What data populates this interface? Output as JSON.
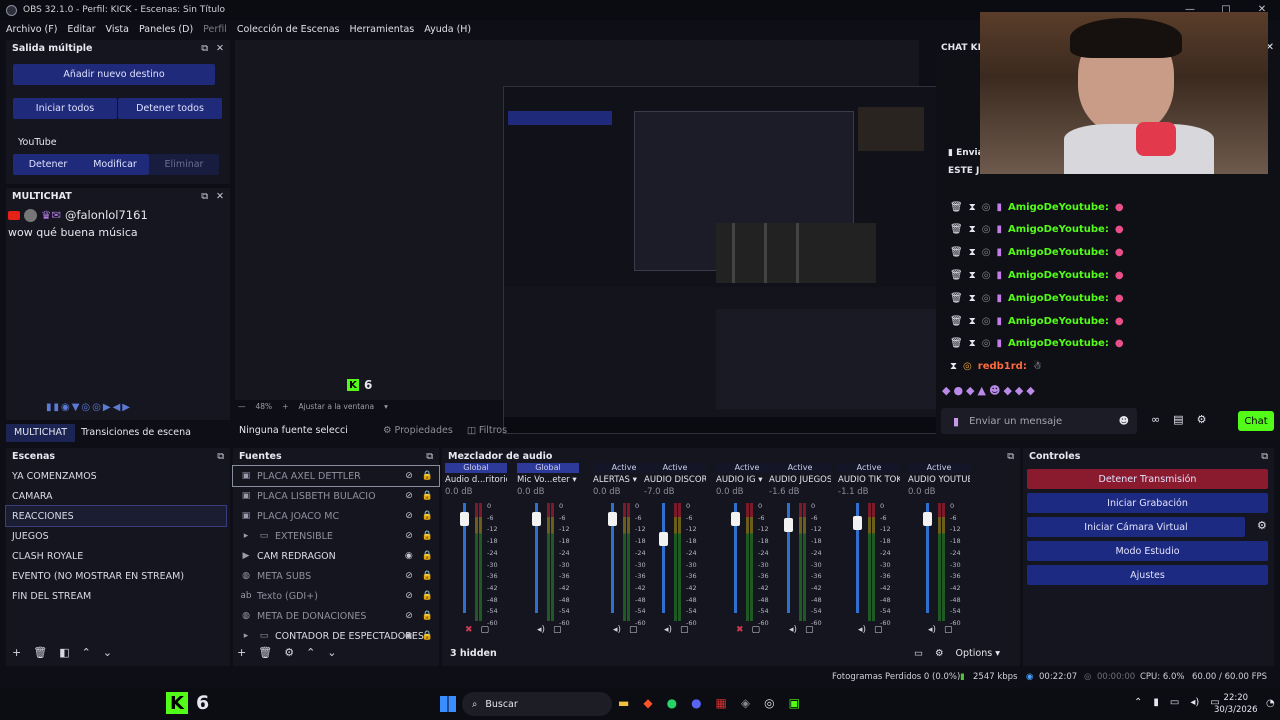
{
  "window": {
    "title": "OBS 32.1.0 - Perfil: KICK - Escenas: Sin Título",
    "controls": [
      "—",
      "□",
      "✕"
    ]
  },
  "menu": {
    "items": [
      "Archivo (F)",
      "Editar",
      "Vista",
      "Paneles (D)",
      "Perfil",
      "Colección de Escenas",
      "Herramientas",
      "Ayuda (H)"
    ]
  },
  "salida": {
    "title": "Salida múltiple",
    "add": "Añadir nuevo destino",
    "start_all": "Iniciar todos",
    "stop_all": "Detener todos",
    "service": "YouTube",
    "stop": "Detener",
    "modify": "Modificar",
    "delete": "Eliminar"
  },
  "multichat": {
    "title": "MULTICHAT",
    "user": "@falonlol7161",
    "message": "wow qué buena música"
  },
  "tabs": {
    "multichat": "MULTICHAT",
    "transitions": "Transiciones de escena"
  },
  "preview": {
    "zoom": "48%",
    "fit": "Ajustar a la ventana",
    "no_source": "Ninguna fuente seleccionada",
    "props": "Propiedades",
    "filters": "Filtros",
    "kick_count": "6"
  },
  "scenes": {
    "title": "Escenas",
    "items": [
      "YA COMENZAMOS",
      "CAMARA",
      "REACCIONES",
      "JUEGOS",
      "CLASH ROYALE",
      "EVENTO (NO MOSTRAR EN STREAM)",
      "FIN DEL STREAM"
    ],
    "selected": 2
  },
  "sources": {
    "title": "Fuentes",
    "items": [
      {
        "name": "PLACA AXEL DETTLER",
        "icon": "image-icon",
        "on": false
      },
      {
        "name": "PLACA LISBETH BULACIO",
        "icon": "image-icon",
        "on": false
      },
      {
        "name": "PLACA JOACO MC",
        "icon": "image-icon",
        "on": false
      },
      {
        "name": "EXTENSIBLE",
        "icon": "folder-icon",
        "on": false
      },
      {
        "name": "CAM REDRAGON",
        "icon": "camera-icon",
        "on": true
      },
      {
        "name": "META SUBS",
        "icon": "globe-icon",
        "on": false
      },
      {
        "name": "Texto (GDI+)",
        "icon": "text-icon",
        "on": false
      },
      {
        "name": "META DE DONACIONES",
        "icon": "globe-icon",
        "on": false
      },
      {
        "name": "CONTADOR DE ESPECTADORES",
        "icon": "folder-icon",
        "on": true
      }
    ]
  },
  "mixer": {
    "title": "Mezclador de audio",
    "hidden": "3 hidden",
    "options": "Options",
    "channels": [
      {
        "tag": "Global",
        "name": "Audio d...ritorio",
        "db": "0.0 dB",
        "level": 0.92,
        "muted": true
      },
      {
        "tag": "Global",
        "name": "Mic Vo...eter",
        "db": "0.0 dB",
        "level": 0.92,
        "muted": false
      },
      {
        "tag": "Active",
        "name": "ALERTAS",
        "db": "0.0 dB",
        "level": 0.92,
        "muted": false
      },
      {
        "tag": "Active",
        "name": "AUDIO DISCORD",
        "db": "-7.0 dB",
        "level": 0.74,
        "muted": false
      },
      {
        "tag": "Active",
        "name": "AUDIO IG",
        "db": "0.0 dB",
        "level": 0.92,
        "muted": true
      },
      {
        "tag": "Active",
        "name": "AUDIO JUEGOS",
        "db": "-1.6 dB",
        "level": 0.86,
        "muted": false
      },
      {
        "tag": "Active",
        "name": "AUDIO TIK TOK",
        "db": "-1.1 dB",
        "level": 0.88,
        "muted": false
      },
      {
        "tag": "Active",
        "name": "AUDIO YOUTUBE",
        "db": "0.0 dB",
        "level": 0.92,
        "muted": false
      }
    ],
    "scale": [
      "0",
      "-6",
      "-12",
      "-18",
      "-24",
      "-30",
      "-36",
      "-42",
      "-48",
      "-54",
      "-60"
    ]
  },
  "controls": {
    "title": "Controles",
    "stop_stream": "Detener Transmisión",
    "start_rec": "Iniciar Grabación",
    "virtual_cam": "Iniciar Cámara Virtual",
    "studio": "Modo Estudio",
    "settings": "Ajustes"
  },
  "chat": {
    "title": "CHAT KICK",
    "send_label": "Envia",
    "banner": "ESTE J",
    "user": "AmigoDeYoutube:",
    "last_user": "redb1rd:",
    "placeholder": "Enviar un mensaje",
    "chat_btn": "Chat"
  },
  "status": {
    "dropped": "Fotogramas Perdidos 0 (0.0%)",
    "kbps": "2547 kbps",
    "stream_time": "00:22:07",
    "rec_time": "00:00:00",
    "cpu": "CPU: 6.0%",
    "fps": "60.00 / 60.00 FPS"
  },
  "taskbar": {
    "search": "Buscar",
    "time": "22:20",
    "date": "30/3/2026"
  },
  "colors": {
    "accent": "#1f2a7a",
    "kick_green": "#53fc18",
    "stop_red": "#8a1b2f"
  }
}
